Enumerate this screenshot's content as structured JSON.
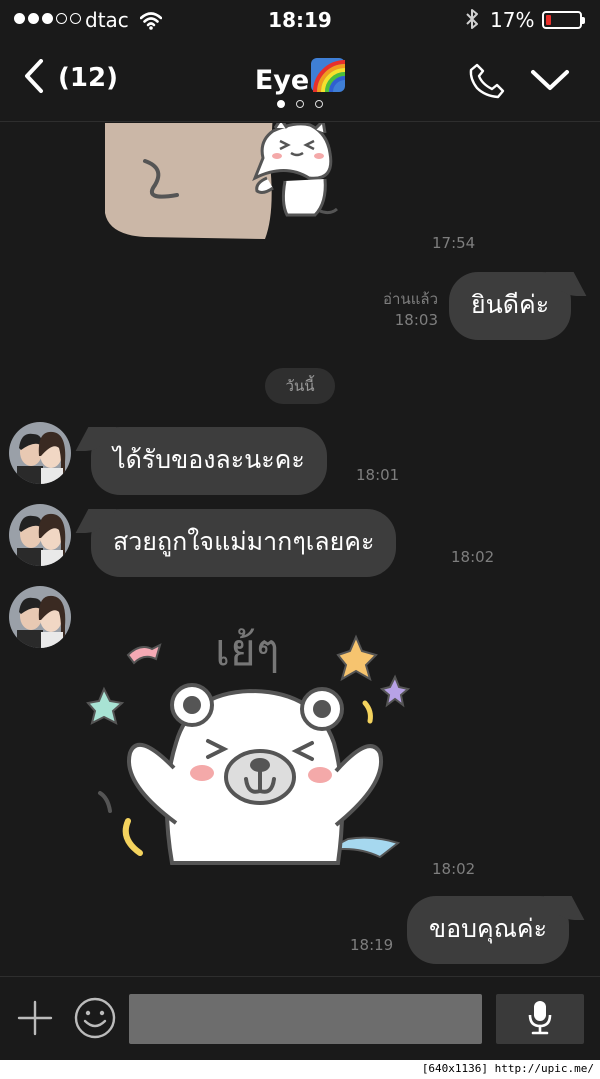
{
  "status_bar": {
    "signal_bars_filled": 3,
    "signal_bars_total": 5,
    "carrier": "dtac",
    "wifi_icon": "wifi-icon",
    "time": "18:19",
    "bluetooth_icon": "bluetooth-icon",
    "battery_percent": "17%",
    "battery_level": 0.17,
    "battery_color": "#e8302b"
  },
  "nav": {
    "back_icon": "chevron-left-icon",
    "unread_count": "(12)",
    "title": "Eye",
    "title_emoji": "rainbow-emoji",
    "page_dots_total": 3,
    "page_dot_active": 1,
    "call_icon": "phone-icon",
    "menu_icon": "chevron-down-icon"
  },
  "messages": [
    {
      "type": "sticker",
      "from": "other",
      "sticker": "cat-hugging-sticker",
      "time": "17:54"
    },
    {
      "type": "text",
      "from": "me",
      "text": "ยินดีค่ะ",
      "read_label": "อ่านแล้ว",
      "time": "18:03"
    },
    {
      "type": "date",
      "text": "วันนี้"
    },
    {
      "type": "text",
      "from": "other",
      "text": "ได้รับของละนะคะ",
      "time": "18:01"
    },
    {
      "type": "text",
      "from": "other",
      "text": "สวยถูกใจแม่มากๆเลยคะ",
      "time": "18:02"
    },
    {
      "type": "sticker",
      "from": "other",
      "sticker": "bear-cheering-sticker",
      "sticker_text": "เย้ๆ",
      "time": "18:02"
    },
    {
      "type": "text",
      "from": "me",
      "text": "ขอบคุณค่ะ",
      "time": "18:19"
    }
  ],
  "input_bar": {
    "plus_icon": "plus-icon",
    "emoji_icon": "emoji-icon",
    "placeholder": "",
    "mic_icon": "microphone-icon"
  },
  "watermark": "[640x1136] http://upic.me/",
  "colors": {
    "background": "#1a1a1a",
    "bubble": "#3d3d3d",
    "timestamp": "#7e7e7e",
    "input_field": "#6d6d6d"
  }
}
